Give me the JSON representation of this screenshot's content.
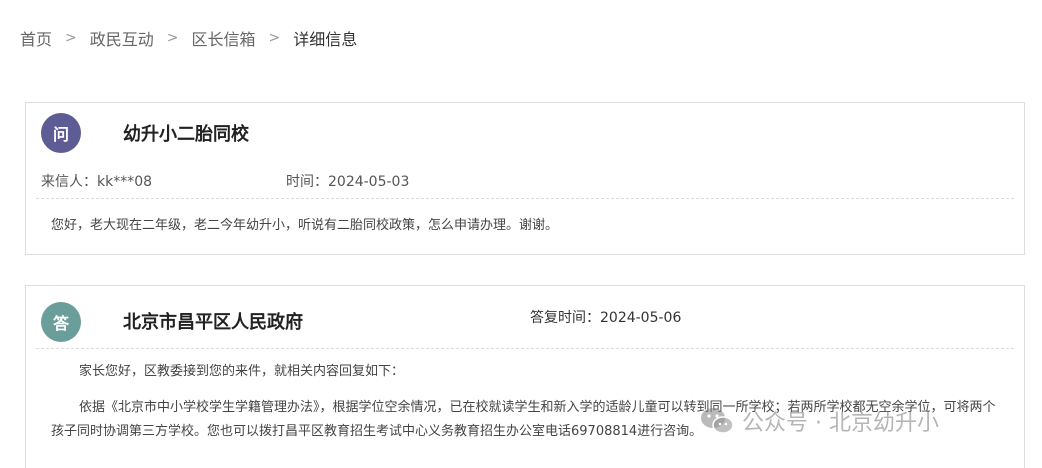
{
  "breadcrumb": {
    "items": [
      "首页",
      "政民互动",
      "区长信箱",
      "详细信息"
    ],
    "separator": ">"
  },
  "question": {
    "badge": "问",
    "badge_color": "#5e5c94",
    "title": "幼升小二胎同校",
    "sender_label": "来信人：kk***08",
    "time_label": "时间：2024-05-03",
    "body": "您好，老大现在二年级，老二今年幼升小，听说有二胎同校政策，怎么申请办理。谢谢。"
  },
  "answer": {
    "badge": "答",
    "badge_color": "#6b9e9a",
    "title": "北京市昌平区人民政府",
    "reply_time_label": "答复时间：2024-05-06",
    "paragraphs": [
      "家长您好，区教委接到您的来件，就相关内容回复如下：",
      "依据《北京市中小学校学生学籍管理办法》，根据学位空余情况，已在校就读学生和新入学的适龄儿童可以转到同一所学校；若两所学校都无空余学位，可将两个孩子同时协调第三方学校。您也可以拨打昌平区教育招生考试中心义务教育招生办公室电话69708814进行咨询。"
    ]
  },
  "watermark": {
    "icon": "wechat-icon",
    "text": "公众号 · 北京幼升小"
  }
}
